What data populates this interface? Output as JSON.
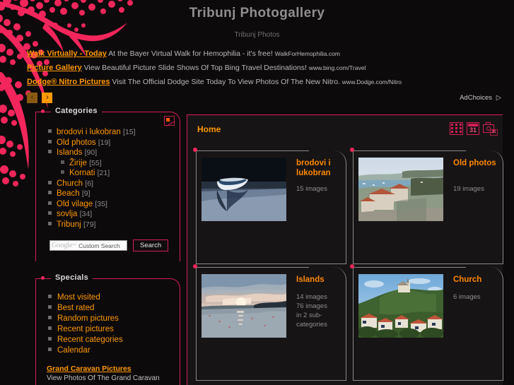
{
  "header": {
    "title": "Tribunj Photogallery",
    "subtitle": "Tribunj Photos"
  },
  "ads": {
    "rows": [
      {
        "title": "Walk Virtually - Today",
        "text": "At the Bayer Virtual Walk for Hemophilia - it's free!",
        "url": "WalkForHemophilia.com"
      },
      {
        "title": "Picture Gallery",
        "text": "View Beautiful Picture Slide Shows Of Top Bing Travel Destinations!",
        "url": "www.bing.com/Travel"
      },
      {
        "title": "Dodge® Nitro Pictures",
        "text": "Visit The Official Dodge Site Today To View Photos Of The New Nitro.",
        "url": "www.Dodge.com/Nitro"
      }
    ],
    "prev_label": "‹",
    "next_label": "›",
    "adchoices_label": "AdChoices",
    "adchoices_glyph": "▷"
  },
  "sidebar": {
    "categories": {
      "legend": "Categories",
      "broken_image_icon": "broken-image-icon",
      "items": [
        {
          "label": "brodovi i lukobran",
          "count": "[15]",
          "sub": false
        },
        {
          "label": "Old photos",
          "count": "[19]",
          "sub": false
        },
        {
          "label": "Islands",
          "count": "[90]",
          "sub": false
        },
        {
          "label": "Žirije",
          "count": "[55]",
          "sub": true
        },
        {
          "label": "Kornati",
          "count": "[21]",
          "sub": true
        },
        {
          "label": "Church",
          "count": "[6]",
          "sub": false
        },
        {
          "label": "Beach",
          "count": "[9]",
          "sub": false
        },
        {
          "label": "Old vilage",
          "count": "[35]",
          "sub": false
        },
        {
          "label": "sovlja",
          "count": "[34]",
          "sub": false
        },
        {
          "label": "Tribunj",
          "count": "[79]",
          "sub": false
        }
      ],
      "search": {
        "logo_text": "Google",
        "logo_tm": "™",
        "placeholder": "Custom Search",
        "value": "",
        "button_label": "Search"
      }
    },
    "specials": {
      "legend": "Specials",
      "items": [
        {
          "label": "Most visited"
        },
        {
          "label": "Best rated"
        },
        {
          "label": "Random pictures"
        },
        {
          "label": "Recent pictures"
        },
        {
          "label": "Recent categories"
        },
        {
          "label": "Calendar"
        }
      ],
      "ad": {
        "title": "Grand Caravan Pictures",
        "text": "View Photos Of The Grand Caravan"
      }
    }
  },
  "main": {
    "breadcrumb": "Home",
    "view_icons": [
      {
        "name": "thumbnail-grid-view-icon",
        "label": ""
      },
      {
        "name": "calendar-view-icon",
        "label": "31"
      },
      {
        "name": "camera-date-view-icon",
        "label": "31"
      }
    ],
    "gallery": [
      {
        "title": "brodovi i lukobran",
        "meta": "15 images",
        "meta2": "",
        "meta3": "",
        "thumb": "boat-on-water"
      },
      {
        "title": "Old photos",
        "meta": "19 images",
        "meta2": "",
        "meta3": "",
        "thumb": "coastal-village"
      },
      {
        "title": "Islands",
        "meta": "14 images",
        "meta2": "76 images",
        "meta3": "in 2 sub-categories",
        "thumb": "sunset-sea"
      },
      {
        "title": "Church",
        "meta": "6 images",
        "meta2": "",
        "meta3": "",
        "thumb": "hilltop-church"
      }
    ]
  },
  "colors": {
    "background": "#0d0a0b",
    "accent_pink": "#d41e55",
    "accent_dot": "#f2265c",
    "link_orange": "#ff9900",
    "title_grey": "#8f8f8f",
    "panel_grey_border": "#8a8a8a"
  }
}
